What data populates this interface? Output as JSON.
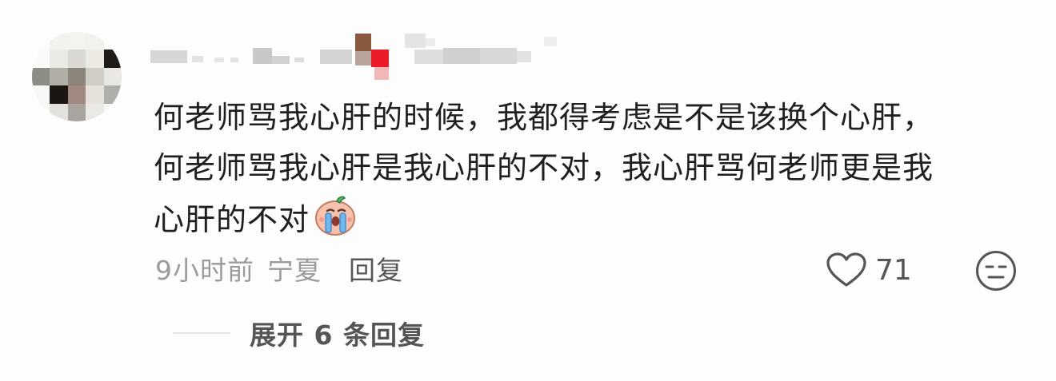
{
  "comment": {
    "lines": [
      "何老师骂我心肝的时候，我都得考虑是不是该换个心肝，",
      "何老师骂我心肝是我心肝的不对，我心肝骂何老师更是我",
      "心肝的不对"
    ],
    "emoji": "crying-face-emoji"
  },
  "meta": {
    "time": "9小时前",
    "location": "宁夏",
    "reply_label": "回复"
  },
  "actions": {
    "like_count": "71",
    "like_icon": "heart-outline-icon",
    "dislike_icon": "neutral-face-icon"
  },
  "replies": {
    "expand_label": "展开 6 条回复"
  },
  "colors": {
    "text": "#1f1f1f",
    "meta": "#9b9b9b",
    "action": "#555555",
    "background": "#fdfdfd"
  }
}
